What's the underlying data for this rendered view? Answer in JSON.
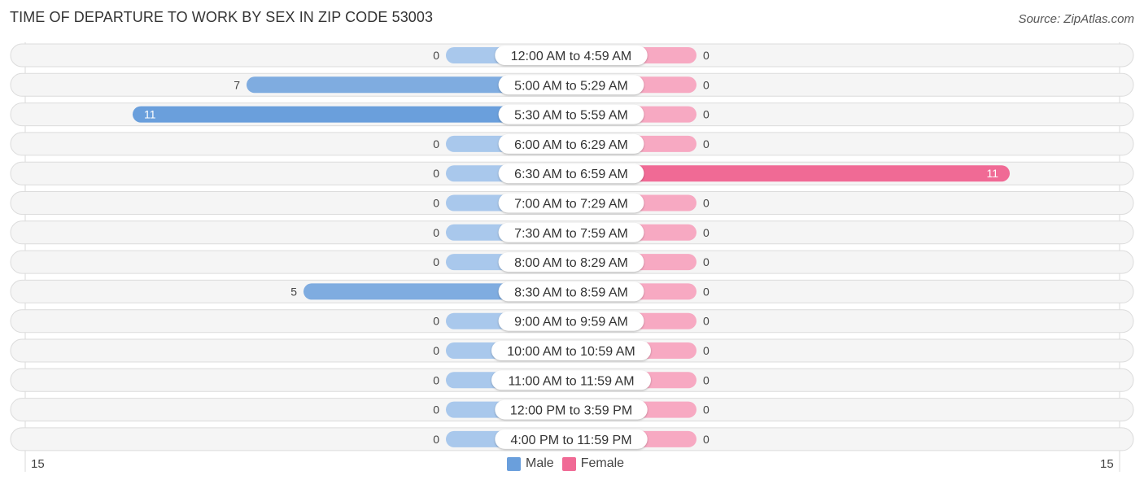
{
  "header": {
    "title": "TIME OF DEPARTURE TO WORK BY SEX IN ZIP CODE 53003",
    "source": "Source: ZipAtlas.com"
  },
  "colors": {
    "male_full": "#6a9fdc",
    "male_light": "#a9c8ec",
    "female_full": "#f06a95",
    "female_light": "#f7a9c2"
  },
  "axis": {
    "left_label": "15",
    "right_label": "15"
  },
  "legend": {
    "male": "Male",
    "female": "Female"
  },
  "chart_data": {
    "type": "bar",
    "orientation": "horizontal-diverging",
    "title": "TIME OF DEPARTURE TO WORK BY SEX IN ZIP CODE 53003",
    "xlim": [
      -15,
      15
    ],
    "legend_position": "bottom-center",
    "categories": [
      "12:00 AM to 4:59 AM",
      "5:00 AM to 5:29 AM",
      "5:30 AM to 5:59 AM",
      "6:00 AM to 6:29 AM",
      "6:30 AM to 6:59 AM",
      "7:00 AM to 7:29 AM",
      "7:30 AM to 7:59 AM",
      "8:00 AM to 8:29 AM",
      "8:30 AM to 8:59 AM",
      "9:00 AM to 9:59 AM",
      "10:00 AM to 10:59 AM",
      "11:00 AM to 11:59 AM",
      "12:00 PM to 3:59 PM",
      "4:00 PM to 11:59 PM"
    ],
    "series": [
      {
        "name": "Male",
        "values": [
          0,
          7,
          11,
          0,
          0,
          0,
          0,
          0,
          5,
          0,
          0,
          0,
          0,
          0
        ]
      },
      {
        "name": "Female",
        "values": [
          0,
          0,
          0,
          0,
          11,
          0,
          0,
          0,
          0,
          0,
          0,
          0,
          0,
          0
        ]
      }
    ]
  }
}
